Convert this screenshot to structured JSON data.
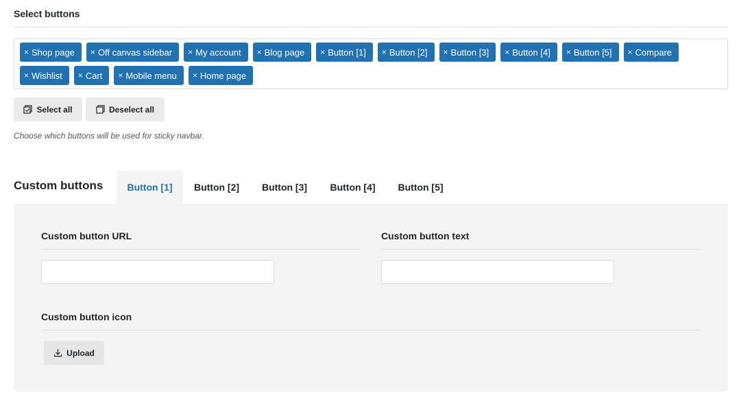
{
  "select_buttons": {
    "title": "Select buttons",
    "tags": [
      {
        "label": "Shop page"
      },
      {
        "label": "Off canvas sidebar"
      },
      {
        "label": "My account"
      },
      {
        "label": "Blog page"
      },
      {
        "label": "Button [1]"
      },
      {
        "label": "Button [2]"
      },
      {
        "label": "Button [3]"
      },
      {
        "label": "Button [4]"
      },
      {
        "label": "Button [5]"
      },
      {
        "label": "Compare"
      },
      {
        "label": "Wishlist"
      },
      {
        "label": "Cart"
      },
      {
        "label": "Mobile menu"
      },
      {
        "label": "Home page"
      }
    ],
    "remove_glyph": "×",
    "select_all_label": "Select all",
    "deselect_all_label": "Deselect all",
    "description": "Choose which buttons will be used for sticky navbar."
  },
  "custom_buttons": {
    "title": "Custom buttons",
    "tabs": [
      {
        "label": "Button [1]",
        "active": true
      },
      {
        "label": "Button [2]",
        "active": false
      },
      {
        "label": "Button [3]",
        "active": false
      },
      {
        "label": "Button [4]",
        "active": false
      },
      {
        "label": "Button [5]",
        "active": false
      }
    ],
    "url_label": "Custom button URL",
    "url_value": "",
    "text_label": "Custom button text",
    "text_value": "",
    "icon_label": "Custom button icon",
    "upload_label": "Upload"
  },
  "colors": {
    "accent": "#2271b1",
    "panel_bg": "#f4f4f4"
  }
}
